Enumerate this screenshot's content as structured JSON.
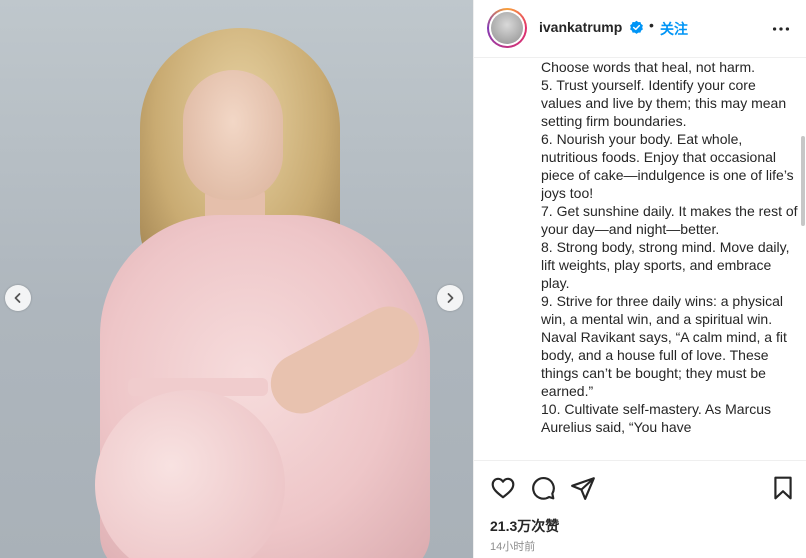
{
  "post": {
    "username": "ivankatrump",
    "follow_label": "关注",
    "separator": "•",
    "caption_lines": [
      "Choose words that heal, not harm.",
      "5. Trust yourself. Identify your core values and live by them; this may mean setting firm boundaries.",
      "6. Nourish your body. Eat whole, nutritious foods. Enjoy that occasional piece of cake—indulgence is one of life’s joys too!",
      "7. Get sunshine daily. It makes the rest of your day—and night—better.",
      "8. Strong body, strong mind. Move daily, lift weights, play sports, and embrace play.",
      "9. Strive for three daily wins: a physical win, a mental win, and a spiritual win. Naval Ravikant says, “A calm mind, a fit body, and a house full of love. These things can’t be bought; they must be earned.”",
      "10. Cultivate self-mastery. As Marcus Aurelius said, “You have"
    ],
    "likes": "21.3万次赞",
    "timestamp": "14小时前"
  },
  "icons": {
    "verified": "verified-badge-icon",
    "more": "more-options-icon",
    "like": "heart-icon",
    "comment": "comment-icon",
    "share": "share-icon",
    "save": "bookmark-icon",
    "prev": "chevron-left-icon",
    "next": "chevron-right-icon"
  },
  "colors": {
    "accent": "#0095f6",
    "text": "#262626",
    "muted": "#8e8e8e"
  }
}
